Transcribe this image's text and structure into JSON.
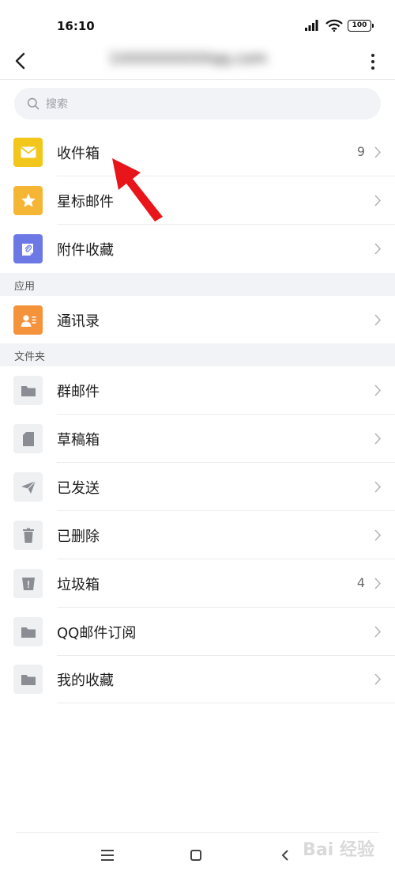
{
  "status_bar": {
    "time": "16:10",
    "battery": "100"
  },
  "header": {
    "account": "1XXXXXXXXXqq.com"
  },
  "search": {
    "placeholder": "搜索"
  },
  "mailboxes": [
    {
      "label": "收件箱",
      "count": "9",
      "icon": "inbox-icon",
      "color": "#f2c61a"
    },
    {
      "label": "星标邮件",
      "count": "",
      "icon": "star-icon",
      "color": "#f6b635"
    },
    {
      "label": "附件收藏",
      "count": "",
      "icon": "attachment-icon",
      "color": "#6c79e5"
    }
  ],
  "sections": {
    "apps": "应用",
    "folders": "文件夹"
  },
  "apps": [
    {
      "label": "通讯录",
      "count": "",
      "icon": "contacts-icon",
      "color": "#f5923c"
    }
  ],
  "folders": [
    {
      "label": "群邮件",
      "count": "",
      "icon": "folder-icon"
    },
    {
      "label": "草稿箱",
      "count": "",
      "icon": "draft-icon"
    },
    {
      "label": "已发送",
      "count": "",
      "icon": "send-icon"
    },
    {
      "label": "已删除",
      "count": "",
      "icon": "trash-icon"
    },
    {
      "label": "垃圾箱",
      "count": "4",
      "icon": "spam-icon"
    },
    {
      "label": "QQ邮件订阅",
      "count": "",
      "icon": "folder-icon"
    },
    {
      "label": "我的收藏",
      "count": "",
      "icon": "folder-icon"
    }
  ],
  "watermark": "Bai 经验",
  "colors": {
    "arrow": "#e8151b",
    "folder_icon": "#8a8d93"
  }
}
